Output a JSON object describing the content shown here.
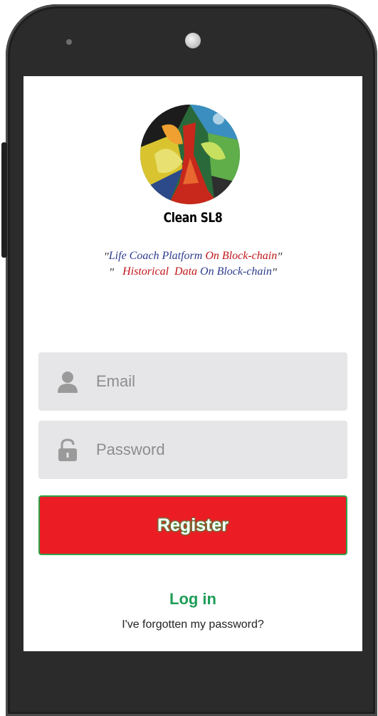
{
  "app": {
    "brand_name": "Clean SL8"
  },
  "tagline": {
    "line1": {
      "open_quote": "\"",
      "part1": "Life Coach Platform ",
      "part2": "On Block-chain",
      "close_quote": "\""
    },
    "line2": {
      "open_quote": "\"",
      "part1": "Historical ",
      "part2": "Data ",
      "part3": "On Block-chain",
      "close_quote": "\""
    }
  },
  "form": {
    "email": {
      "placeholder": "Email",
      "value": "",
      "icon": "user-icon"
    },
    "password": {
      "placeholder": "Password",
      "value": "",
      "icon": "lock-icon"
    },
    "register_label": "Register"
  },
  "links": {
    "login_label": "Log in",
    "forgot_label": "I've forgotten my password?"
  },
  "colors": {
    "register_bg": "#ec1c24",
    "register_border": "#2ea34a",
    "login_link": "#1f9d57",
    "field_bg": "#e6e6e8",
    "tagline_blue": "#2d3c8c",
    "tagline_red": "#c0151b"
  }
}
